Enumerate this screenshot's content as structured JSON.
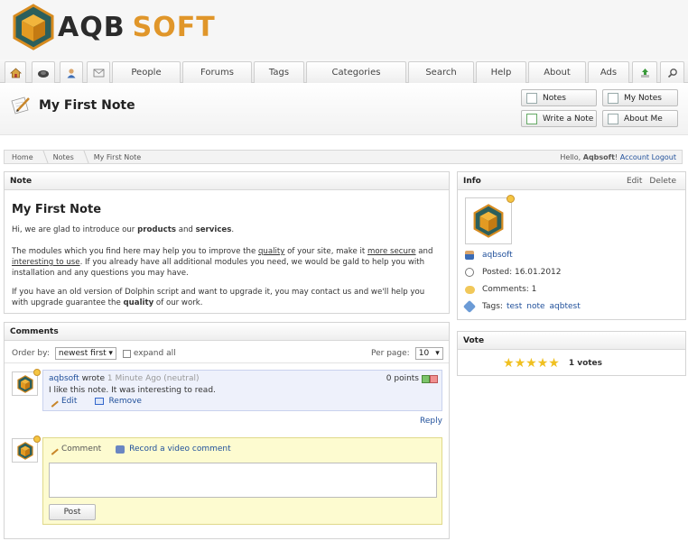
{
  "logo": {
    "part1": "AQB",
    "part2": "SOFT"
  },
  "nav": {
    "tabs": [
      "People",
      "Forums",
      "Tags",
      "Categories",
      "Search",
      "Help",
      "About",
      "Ads"
    ]
  },
  "page": {
    "title": "My First Note"
  },
  "header_buttons": {
    "notes": "Notes",
    "my_notes": "My Notes",
    "write_note": "Write a Note",
    "about_me": "About Me"
  },
  "breadcrumb": {
    "home": "Home",
    "notes": "Notes",
    "current": "My First Note",
    "greeting": "Hello,",
    "username": "Aqbsoft",
    "account": "Account",
    "logout": "Logout"
  },
  "note": {
    "box_title": "Note",
    "title": "My First Note",
    "p1_a": "Hi, we are glad to introduce our ",
    "p1_products": "products",
    "p1_and": " and ",
    "p1_services": "services",
    "p1_end": ".",
    "p2_a": "The modules which you find here may help you to improve the ",
    "p2_quality": "quality",
    "p2_b": " of your site, make it ",
    "p2_secure": "more secure",
    "p2_c": " and ",
    "p2_interesting": "interesting to use",
    "p2_d": ". If you already have all additional modules you need, we would be gald to help you with installation and any questions you may have.",
    "p3_a": "If you have an old version of Dolphin script and want to upgrade it, you may contact us and we'll help you with upgrade guarantee the ",
    "p3_quality": "quality",
    "p3_b": " of our work."
  },
  "info": {
    "box_title": "Info",
    "edit": "Edit",
    "delete": "Delete",
    "author": "aqbsoft",
    "posted": "Posted: 16.01.2012",
    "comments": "Comments: 1",
    "tags_label": "Tags:",
    "tags": [
      "test",
      "note",
      "aqbtest"
    ]
  },
  "vote": {
    "box_title": "Vote",
    "stars": 5,
    "votes": "1 votes"
  },
  "comments": {
    "box_title": "Comments",
    "order_label": "Order by:",
    "order_value": "newest first",
    "expand_all": "expand all",
    "per_page_label": "Per page:",
    "per_page_value": "10",
    "items": [
      {
        "author": "aqbsoft",
        "wrote": "wrote",
        "time": "1 Minute Ago (neutral)",
        "points": "0 points",
        "text": "I like this note. It was interesting to read.",
        "edit": "Edit",
        "remove": "Remove",
        "reply": "Reply"
      }
    ],
    "form": {
      "tab_comment": "Comment",
      "tab_video": "Record a video comment",
      "post": "Post"
    }
  },
  "colors": {
    "accent_orange": "#e0962a",
    "link_blue": "#1f4f9a",
    "comment_bg": "#eef1fb",
    "form_bg": "#fdfbd0"
  }
}
